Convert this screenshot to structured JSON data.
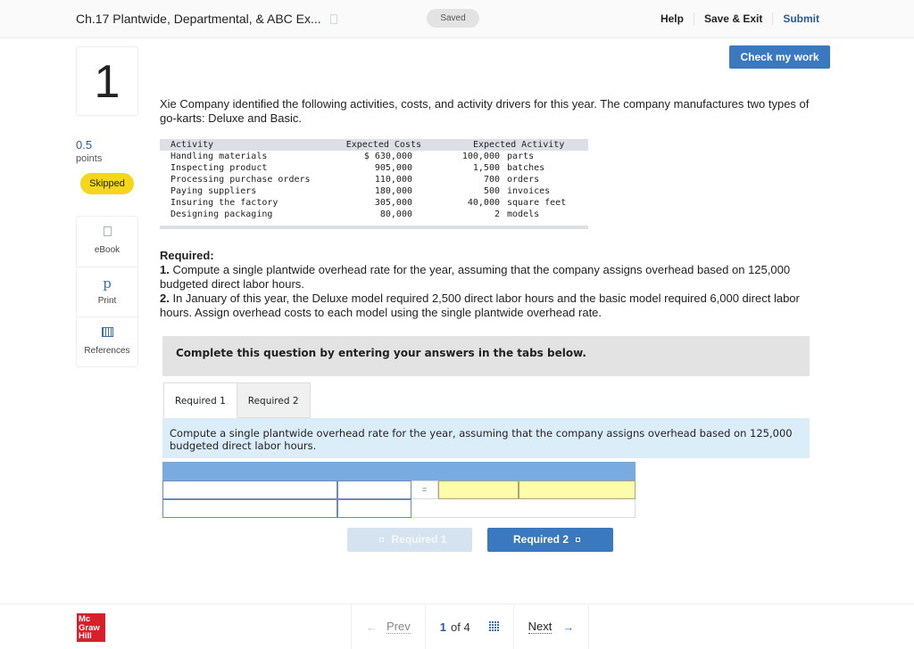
{
  "header": {
    "assignment_title": "Ch.17 Plantwide, Departmental, & ABC Ex...",
    "saved_status": "Saved",
    "help": "Help",
    "save_exit": "Save & Exit",
    "submit": "Submit",
    "check_my_work": "Check my work"
  },
  "question": {
    "number": "1",
    "points_value": "0.5",
    "points_label": "points",
    "status": "Skipped"
  },
  "tools": [
    {
      "icon": "ebook-icon",
      "label": "eBook"
    },
    {
      "icon": "print-icon",
      "label": "Print"
    },
    {
      "icon": "references-icon",
      "label": "References"
    }
  ],
  "intro_text": "Xie Company identified the following activities, costs, and activity drivers for this year. The company manufactures two types of go-karts: Deluxe and Basic.",
  "activity_table": {
    "headers": [
      "Activity",
      "Expected Costs",
      "Expected Activity"
    ],
    "rows": [
      {
        "activity": "Handling materials",
        "cost": "$ 630,000",
        "qty": "100,000",
        "unit": "parts"
      },
      {
        "activity": "Inspecting product",
        "cost": "905,000",
        "qty": "1,500",
        "unit": "batches"
      },
      {
        "activity": "Processing purchase orders",
        "cost": "110,000",
        "qty": "700",
        "unit": "orders"
      },
      {
        "activity": "Paying suppliers",
        "cost": "180,000",
        "qty": "500",
        "unit": "invoices"
      },
      {
        "activity": "Insuring the factory",
        "cost": "305,000",
        "qty": "40,000",
        "unit": "square feet"
      },
      {
        "activity": "Designing packaging",
        "cost": "80,000",
        "qty": "2",
        "unit": "models"
      }
    ]
  },
  "required": {
    "heading": "Required:",
    "item1_num": "1.",
    "item1_text": " Compute a single plantwide overhead rate for the year, assuming that the company assigns overhead based on 125,000 budgeted direct labor hours.",
    "item2_num": "2.",
    "item2_text": " In January of this year, the Deluxe model required 2,500 direct labor hours and the basic model required 6,000 direct labor hours. Assign overhead costs to each model using the single plantwide overhead rate."
  },
  "instructions": "Complete this question by entering your answers in the tabs below.",
  "tabs": [
    {
      "label": "Required 1",
      "active": true
    },
    {
      "label": "Required 2",
      "active": false
    }
  ],
  "tab_description": "Compute a single plantwide overhead rate for the year, assuming that the company assigns overhead based on 125,000 budgeted direct labor hours.",
  "answer_grid": {
    "operator": "=",
    "row1": [
      "",
      "",
      "",
      ""
    ],
    "row2": [
      "",
      ""
    ]
  },
  "nav_buttons": {
    "prev_label": "Required 1",
    "next_label": "Required 2"
  },
  "footer": {
    "logo_lines": [
      "Mc",
      "Graw",
      "Hill"
    ],
    "prev": "Prev",
    "current_page": "1",
    "of_label": "of",
    "total_pages": "4",
    "next": "Next",
    "prev_arrow": "←",
    "next_arrow": "→"
  }
}
